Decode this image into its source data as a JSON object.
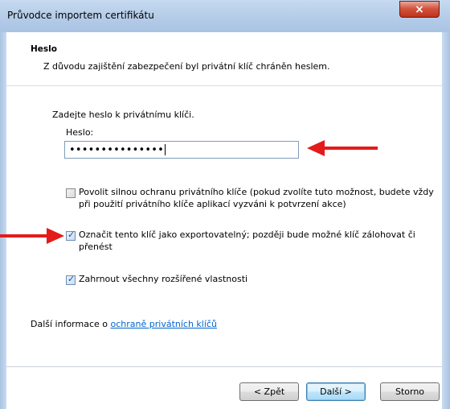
{
  "window": {
    "title": "Průvodce importem certifikátu",
    "close_icon": "×"
  },
  "header": {
    "title": "Heslo",
    "subtitle": "Z důvodu zajištění zabezpečení byl privátní klíč chráněn heslem."
  },
  "main": {
    "instruction": "Zadejte heslo k privátnímu klíči.",
    "password_label": "Heslo:",
    "password_value": "•••••••••••••••",
    "options": [
      {
        "line1": "Povolit silnou ochranu privátního klíče (pokud zvolíte tuto možnost, budete vždy",
        "line2": "při použití privátního klíče aplikací vyzváni k potvrzení akce)",
        "checked": false
      },
      {
        "line1": "Označit tento klíč jako exportovatelný; později bude možné klíč zálohovat či",
        "line2": "přenést",
        "checked": true
      },
      {
        "line1": "Zahrnout všechny rozšířené vlastnosti",
        "line2": "",
        "checked": true
      }
    ],
    "more_info_prefix": "Další informace o ",
    "more_info_link": "ochraně privátních klíčů"
  },
  "buttons": {
    "back": "< Zpět",
    "next": "Další >",
    "cancel": "Storno"
  },
  "colors": {
    "annotation_arrow": "#e31b1b",
    "link": "#0066cc"
  }
}
